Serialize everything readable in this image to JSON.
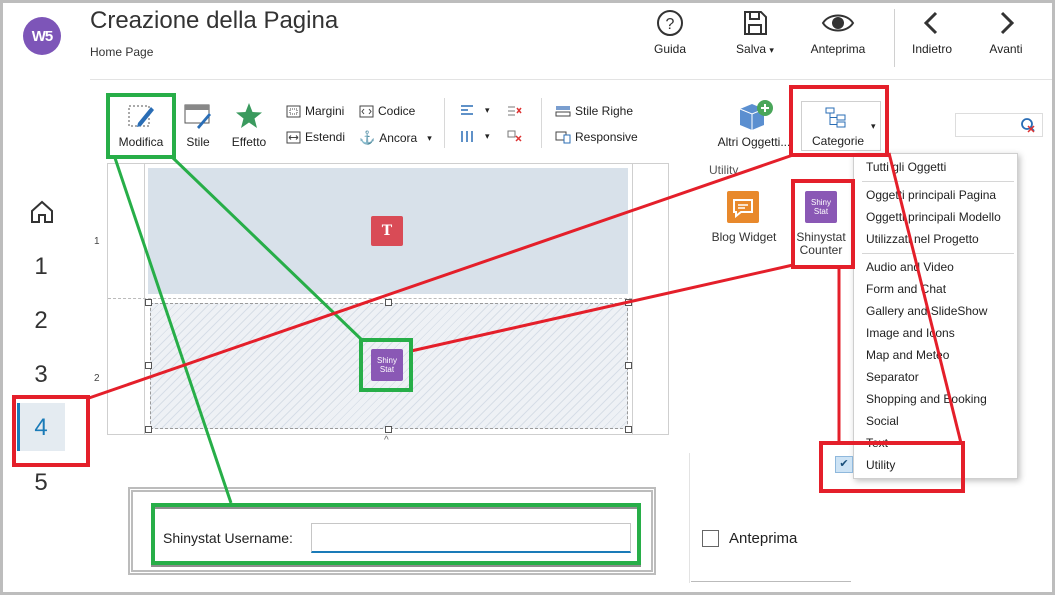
{
  "header": {
    "app_logo": "W5",
    "title": "Creazione della Pagina",
    "subtitle": "Home Page",
    "buttons": {
      "help": "Guida",
      "save": "Salva",
      "save_arrow": "▾",
      "preview": "Anteprima",
      "back": "Indietro",
      "forward": "Avanti"
    }
  },
  "toolbar": {
    "edit": "Modifica",
    "style": "Stile",
    "effect": "Effetto",
    "margins": "Margini",
    "extend": "Estendi",
    "code": "Codice",
    "anchor": "Ancora",
    "anchor_arrow": "▾",
    "row_style": "Stile Righe",
    "responsive": "Responsive",
    "other_objects": "Altri Oggetti...",
    "categories": "Categorie",
    "categories_arrow": "▾"
  },
  "nav": {
    "items": [
      "1",
      "2",
      "3",
      "4",
      "5"
    ],
    "active": "4"
  },
  "canvas": {
    "row_labels": [
      "1",
      "2"
    ],
    "text_object_glyph": "T",
    "shinystat_icon_text": [
      "Shiny",
      "Stat"
    ]
  },
  "objects_panel": {
    "group_label": "Utility",
    "objects": [
      {
        "label": "Blog Widget",
        "icon": "speech-bubble-icon",
        "color": "#e8892c"
      },
      {
        "label": "Shinystat Counter",
        "label_line1": "Shinystat",
        "label_line2": "Counter",
        "icon": "shinystat-icon",
        "color": "#8a58b5"
      }
    ]
  },
  "categories_menu": {
    "group1": [
      "Tutti gli Oggetti"
    ],
    "group2": [
      "Oggetti principali Pagina",
      "Oggetti principali Modello",
      "Utilizzati nel Progetto"
    ],
    "group3": [
      "Audio and Video",
      "Form and Chat",
      "Gallery and SlideShow",
      "Image and Icons",
      "Map and Meteo",
      "Separator",
      "Shopping and Booking",
      "Social",
      "Text",
      "Utility"
    ],
    "checked": "Utility",
    "check_glyph": "✔"
  },
  "properties": {
    "username_label": "Shinystat Username:",
    "username_value": "",
    "preview_label": "Anteprima",
    "preview_checked": false
  },
  "colors": {
    "highlight_green": "#27ae48",
    "highlight_red": "#e41f2a",
    "accent_blue": "#1a7bb8",
    "logo_purple": "#7d55b8"
  }
}
